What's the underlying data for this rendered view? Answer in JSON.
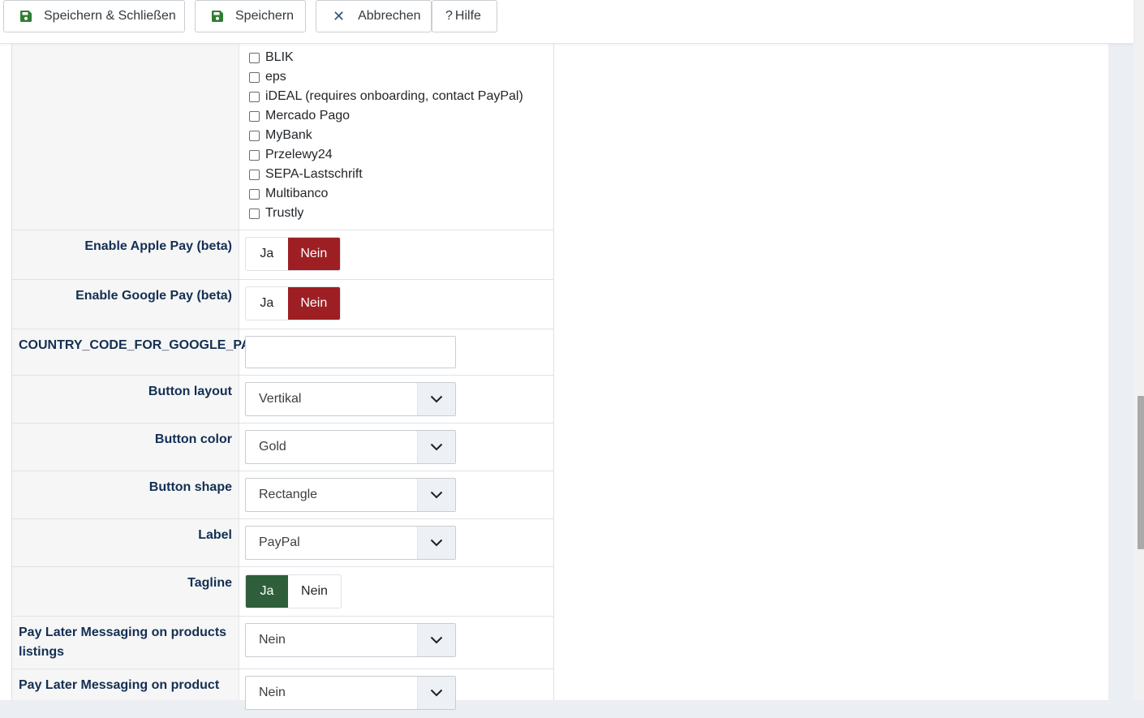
{
  "toolbar": {
    "save_close_label": "Speichern & Schließen",
    "save_label": "Speichern",
    "cancel_label": "Abbrechen",
    "help_label": "Hilfe",
    "help_prefix": "?",
    "cancel_icon_glyph": "✕",
    "icons": {
      "save": "floppy-disk-icon",
      "cancel": "close-icon",
      "help": "question-icon"
    },
    "save_icon_color": "#2e7d32"
  },
  "payment_methods": [
    {
      "label": "BLIK",
      "checked": false
    },
    {
      "label": "eps",
      "checked": false
    },
    {
      "label": "iDEAL (requires onboarding, contact PayPal)",
      "checked": false
    },
    {
      "label": "Mercado Pago",
      "checked": false
    },
    {
      "label": "MyBank",
      "checked": false
    },
    {
      "label": "Przelewy24",
      "checked": false
    },
    {
      "label": "SEPA-Lastschrift",
      "checked": false
    },
    {
      "label": "Multibanco",
      "checked": false
    },
    {
      "label": "Trustly",
      "checked": false
    }
  ],
  "fields": {
    "apple_pay": {
      "label": "Enable Apple Pay (beta)",
      "yes": "Ja",
      "no": "Nein",
      "selected": "Nein"
    },
    "google_pay": {
      "label": "Enable Google Pay (beta)",
      "yes": "Ja",
      "no": "Nein",
      "selected": "Nein"
    },
    "country_code": {
      "label": "COUNTRY_CODE_FOR_GOOGLE_PAY",
      "value": ""
    },
    "button_layout": {
      "label": "Button layout",
      "value": "Vertikal"
    },
    "button_color": {
      "label": "Button color",
      "value": "Gold"
    },
    "button_shape": {
      "label": "Button shape",
      "value": "Rectangle"
    },
    "label": {
      "label": "Label",
      "value": "PayPal"
    },
    "tagline": {
      "label": "Tagline",
      "yes": "Ja",
      "no": "Nein",
      "selected": "Ja"
    },
    "pay_later_listings": {
      "label_line1": "Pay Later Messaging on products",
      "label_line2": "listings",
      "value": "Nein"
    },
    "pay_later_product": {
      "label_line1": "Pay Later Messaging on product",
      "value": "Nein"
    }
  },
  "colors": {
    "toggle_no_active": "#9e1f23",
    "toggle_yes_active": "#2e5f3a",
    "label_text": "#132f53"
  }
}
